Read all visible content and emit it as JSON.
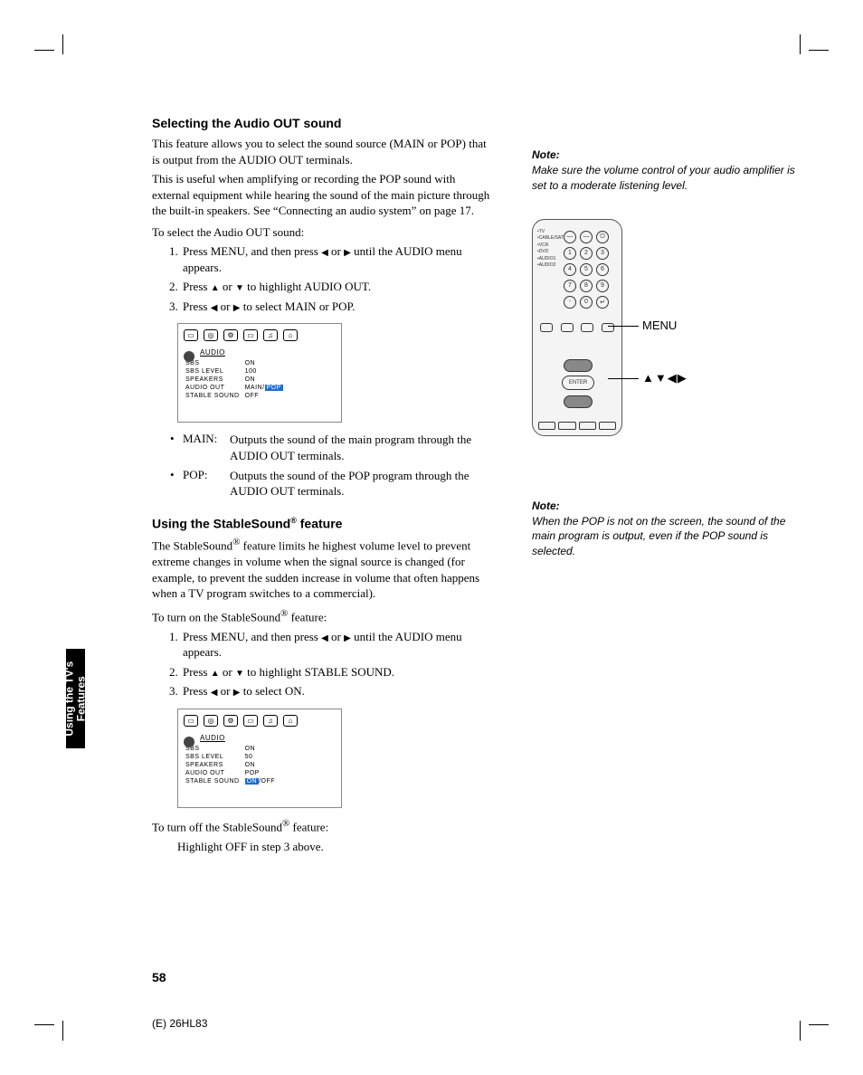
{
  "section1": {
    "heading": "Selecting the Audio OUT sound",
    "p1": "This feature allows you to select the sound source (MAIN or POP) that is output from the AUDIO OUT terminals.",
    "p2": "This is useful when amplifying or recording the POP sound with external equipment while hearing the sound of the main picture through the built-in speakers. See “Connecting an audio system” on page 17.",
    "inst": "To select the Audio OUT sound:",
    "s1a": "Press MENU, and then press ",
    "s1b": " or ",
    "s1c": " until the AUDIO menu appears.",
    "s2a": "Press ",
    "s2b": " or ",
    "s2c": " to highlight AUDIO OUT.",
    "s3a": "Press ",
    "s3b": " or ",
    "s3c": " to select MAIN or POP.",
    "def_main_l": "MAIN:",
    "def_main_d": "Outputs the sound of the main program through the AUDIO OUT terminals.",
    "def_pop_l": "POP:",
    "def_pop_d": "Outputs the sound of the POP program through the AUDIO OUT terminals."
  },
  "section2": {
    "heading_a": "Using the StableSound",
    "heading_b": " feature",
    "p1a": "The StableSound",
    "p1b": " feature limits he highest volume level to prevent extreme changes in volume when the signal source is changed (for example, to prevent the sudden increase in volume that often happens when a TV program switches to a commercial).",
    "inst1a": "To turn on the StableSound",
    "inst1b": " feature:",
    "s1a": "Press MENU, and then press ",
    "s1b": " or ",
    "s1c": " until the AUDIO menu appears.",
    "s2a": "Press ",
    "s2b": " or ",
    "s2c": " to highlight STABLE SOUND.",
    "s3a": "Press ",
    "s3b": " or ",
    "s3c": " to select ON.",
    "off1a": "To turn off the StableSound",
    "off1b": " feature:",
    "off2": "Highlight OFF in step 3 above."
  },
  "osd1": {
    "title": "AUDIO",
    "rows": [
      [
        "SBS",
        "ON"
      ],
      [
        "SBS LEVEL",
        "100"
      ],
      [
        "SPEAKERS",
        "ON"
      ],
      [
        "AUDIO OUT",
        "MAIN/"
      ],
      [
        "STABLE SOUND",
        "OFF"
      ]
    ],
    "hl": "POP"
  },
  "osd2": {
    "title": "AUDIO",
    "rows": [
      [
        "SBS",
        "ON"
      ],
      [
        "SBS LEVEL",
        "50"
      ],
      [
        "SPEAKERS",
        "ON"
      ],
      [
        "AUDIO OUT",
        "POP"
      ],
      [
        "STABLE SOUND",
        ""
      ]
    ],
    "hl": "ON",
    "after": "/OFF"
  },
  "side": {
    "note_h": "Note:",
    "note1": "Make sure the volume control of your audio amplifier is set to a moderate listening level.",
    "note2": "When the POP is not on the screen, the sound of the main program is output, even if the POP sound is selected.",
    "callout_menu": "MENU",
    "callout_arrows": "▲▼◀▶"
  },
  "remote": {
    "devices": "•TV\n•CABLE/SAT\n•VCR\n•DVD\n•AUDIO1\n•AUDIO2",
    "enter": "ENTER"
  },
  "tab": "Using the TV's\nFeatures",
  "page_number": "58",
  "footer": "(E) 26HL83",
  "glyph": {
    "left": "◀",
    "right": "▶",
    "up": "▲",
    "down": "▼",
    "reg": "®",
    "bullet": "•"
  }
}
